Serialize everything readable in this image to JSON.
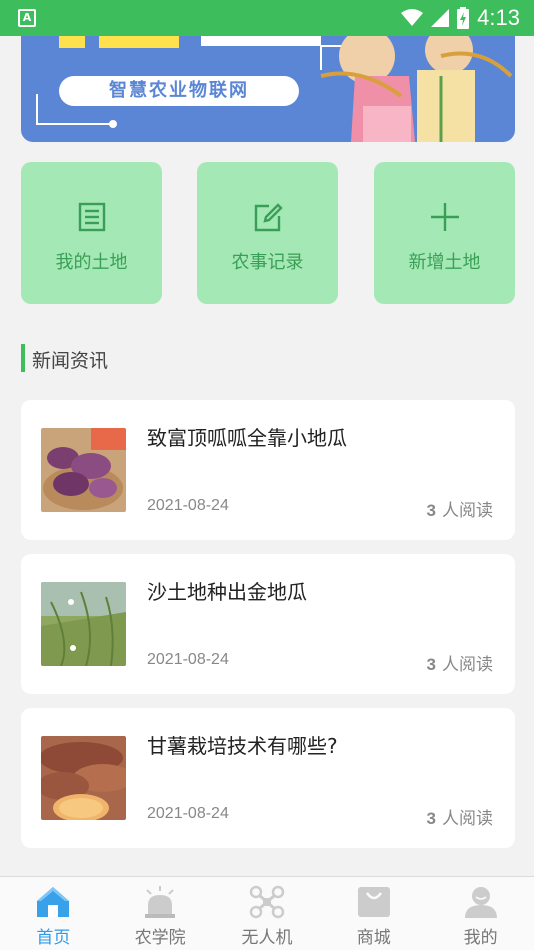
{
  "status_bar": {
    "time": "4:13",
    "app_indicator": "A"
  },
  "banner": {
    "tagline": "智慧农业物联网"
  },
  "quick_actions": [
    {
      "label": "我的土地",
      "icon": "list-icon"
    },
    {
      "label": "农事记录",
      "icon": "edit-icon"
    },
    {
      "label": "新增土地",
      "icon": "plus-icon"
    }
  ],
  "news": {
    "section_title": "新闻资讯",
    "items": [
      {
        "title": "致富顶呱呱全靠小地瓜",
        "date": "2021-08-24",
        "read_count": "3",
        "read_suffix": "人阅读"
      },
      {
        "title": "沙土地种出金地瓜",
        "date": "2021-08-24",
        "read_count": "3",
        "read_suffix": "人阅读"
      },
      {
        "title": "甘薯栽培技术有哪些?",
        "date": "2021-08-24",
        "read_count": "3",
        "read_suffix": "人阅读"
      }
    ]
  },
  "tab_bar": {
    "tabs": [
      {
        "label": "首页",
        "active": true
      },
      {
        "label": "农学院",
        "active": false
      },
      {
        "label": "无人机",
        "active": false
      },
      {
        "label": "商城",
        "active": false
      },
      {
        "label": "我的",
        "active": false
      }
    ]
  },
  "colors": {
    "primary_green": "#3dbd5b",
    "tile_green": "#a4e9b5",
    "banner_blue": "#5b86d6",
    "tab_active": "#2f9be6"
  }
}
